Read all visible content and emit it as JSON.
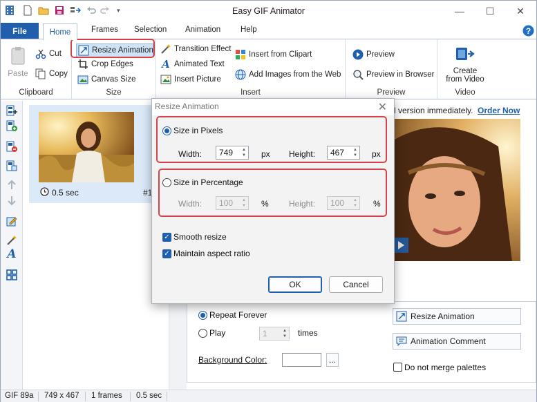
{
  "window": {
    "title": "Easy GIF Animator"
  },
  "menu_tabs": [
    "File",
    "Home",
    "Frames",
    "Selection",
    "Animation",
    "Help"
  ],
  "ribbon": {
    "clipboard": {
      "label": "Clipboard",
      "paste": "Paste",
      "cut": "Cut",
      "copy": "Copy"
    },
    "size": {
      "label": "Size",
      "resize": "Resize Animation",
      "crop": "Crop Edges",
      "canvas": "Canvas Size"
    },
    "insert": {
      "label": "Insert",
      "transition": "Transition Effect",
      "animated_text": "Animated Text",
      "insert_picture": "Insert Picture",
      "clipart": "Insert from Clipart",
      "web": "Add Images from the Web"
    },
    "preview": {
      "label": "Preview",
      "preview": "Preview",
      "browser": "Preview in Browser"
    },
    "video": {
      "label": "Video",
      "create1": "Create",
      "create2": "from Video"
    }
  },
  "frame": {
    "duration": "0.5 sec",
    "index": "#1"
  },
  "banner": {
    "text": "l version immediately.",
    "link": "Order Now"
  },
  "props": {
    "repeat_forever": "Repeat Forever",
    "play": "Play",
    "play_count": "1",
    "times": "times",
    "bg_color": "Background Color:",
    "browse": "...",
    "resize_btn": "Resize Animation",
    "comment_btn": "Animation Comment",
    "no_merge": "Do not merge palettes"
  },
  "status": {
    "format": "GIF 89a",
    "dimensions": "749 x 467",
    "frames": "1 frames",
    "time": "0.5 sec"
  },
  "dialog": {
    "title": "Resize Animation",
    "pixels_label": "Size in Pixels",
    "percent_label": "Size in Percentage",
    "width_label": "Width:",
    "height_label": "Height:",
    "px": "px",
    "pct": "%",
    "width_px": "749",
    "height_px": "467",
    "width_pct": "100",
    "height_pct": "100",
    "smooth": "Smooth resize",
    "aspect": "Maintain aspect ratio",
    "ok": "OK",
    "cancel": "Cancel"
  },
  "colors": {
    "accent": "#1f5fae",
    "highlight": "#d8434b"
  }
}
